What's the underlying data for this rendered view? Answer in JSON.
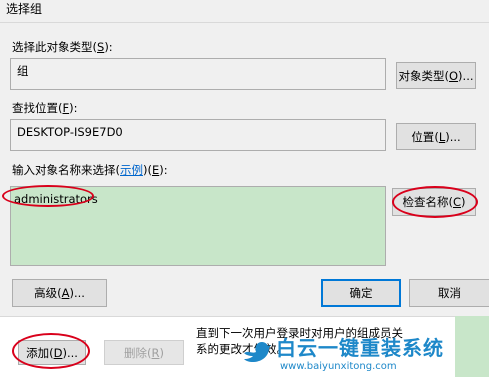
{
  "window": {
    "title": "选择组"
  },
  "object_type": {
    "label": "选择此对象类型",
    "key": "S",
    "value": "组",
    "button": {
      "text": "对象类型",
      "key": "O"
    }
  },
  "location": {
    "label": "查找位置",
    "key": "F",
    "value": "DESKTOP-IS9E7D0",
    "button": {
      "text": "位置",
      "key": "L"
    }
  },
  "names": {
    "label": "输入对象名称来选择",
    "link": "示例",
    "key": "E",
    "value": "administrators",
    "check_button": {
      "text": "检查名称",
      "key": "C"
    }
  },
  "advanced_button": {
    "text": "高级",
    "key": "A"
  },
  "ok_button": {
    "text": "确定"
  },
  "cancel_button": {
    "text": "取消"
  },
  "bottom": {
    "add_button": {
      "text": "添加",
      "key": "D"
    },
    "remove_button": {
      "text": "删除",
      "key": "R"
    },
    "info_line1": "直到下一次用户登录时对用户的组成员关",
    "info_line2": "系的更改才生效。"
  },
  "watermark": {
    "brand": "白云一键重装系统",
    "url": "www.baiyunxitong.com"
  },
  "colors": {
    "accent": "#0078d7",
    "annotation": "#d9001b",
    "names_background": "#c8e6c9"
  }
}
